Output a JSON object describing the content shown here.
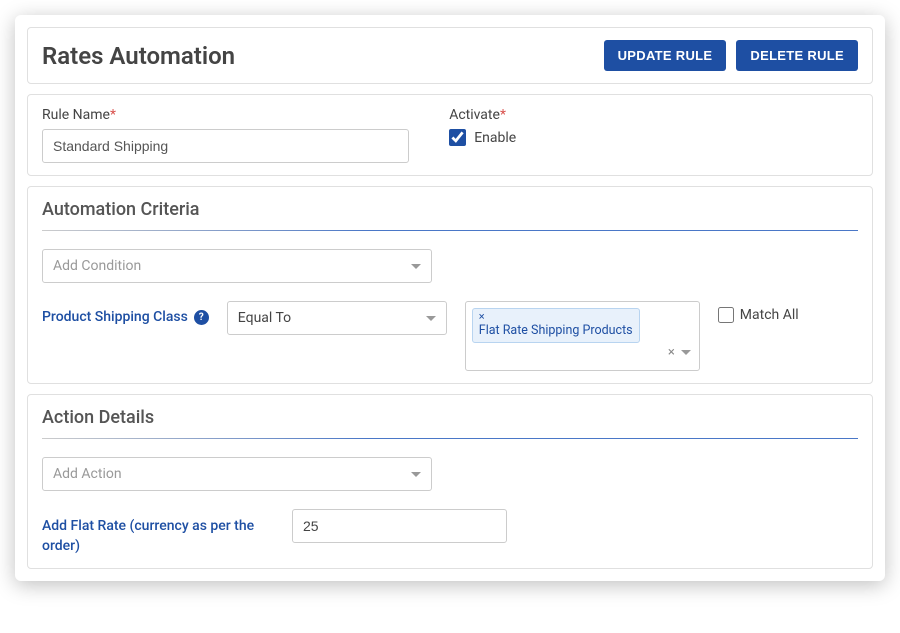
{
  "header": {
    "title": "Rates Automation",
    "update_btn": "UPDATE RULE",
    "delete_btn": "DELETE RULE"
  },
  "rule": {
    "name_label": "Rule Name",
    "name_value": "Standard Shipping",
    "activate_label": "Activate",
    "enable_label": "Enable",
    "enable_checked": true
  },
  "criteria": {
    "section_title": "Automation Criteria",
    "add_condition_placeholder": "Add Condition",
    "field_label": "Product Shipping Class",
    "operator": "Equal To",
    "tokens": [
      "Flat Rate Shipping Products"
    ],
    "match_all_label": "Match All",
    "match_all_checked": false
  },
  "actions": {
    "section_title": "Action Details",
    "add_action_placeholder": "Add Action",
    "flat_rate_label": "Add Flat Rate (currency as per the order)",
    "flat_rate_value": "25"
  }
}
